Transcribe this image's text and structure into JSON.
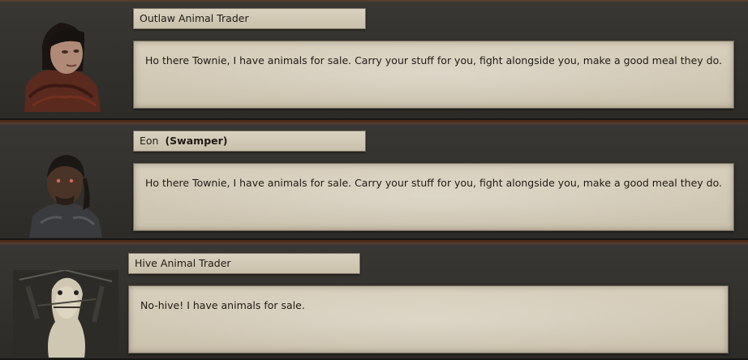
{
  "dialogue": {
    "entries": [
      {
        "speaker": "Outlaw Animal Trader",
        "faction": "",
        "portrait_icon": "female-outlaw-portrait",
        "text": "Ho there Townie, I have animals for sale.  Carry your stuff for you, fight alongside you, make a good meal they do."
      },
      {
        "speaker": "Eon",
        "faction": "(Swamper)",
        "portrait_icon": "swamper-man-portrait",
        "text": "Ho there Townie, I have animals for sale.  Carry your stuff for you, fight alongside you, make a good meal they do."
      },
      {
        "speaker": "Hive Animal Trader",
        "faction": "",
        "portrait_icon": "hive-trader-portrait",
        "text": "No-hive! I have animals for sale."
      }
    ]
  },
  "colors": {
    "panel_background": "#2e2c29",
    "parchment": "#d3cab6",
    "rust_accent": "#7d3c19",
    "text": "#1f1b15"
  }
}
